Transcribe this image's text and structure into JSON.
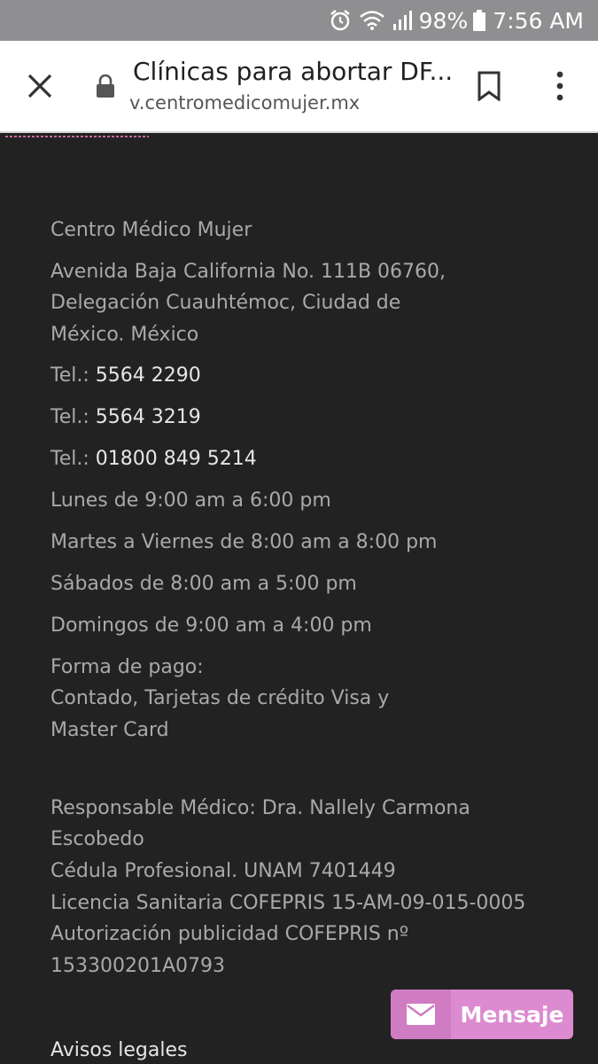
{
  "status_bar": {
    "battery": "98%",
    "time": "7:56 AM"
  },
  "browser": {
    "title": "Clínicas para abortar DF...",
    "url": "v.centromedicomujer.mx"
  },
  "clinic": {
    "name": "Centro Médico Mujer",
    "address": [
      "Avenida Baja California No. 111B 06760,",
      "Delegación Cuauhtémoc, Ciudad de",
      "México. México"
    ],
    "phones": [
      {
        "label": "Tel.:",
        "number": "5564 2290"
      },
      {
        "label": "Tel.:",
        "number": "5564 3219"
      },
      {
        "label": "Tel.:",
        "number": "01800 849 5214"
      }
    ],
    "hours": [
      "Lunes de 9:00 am a 6:00 pm",
      "Martes a Viernes de 8:00 am a 8:00 pm",
      "Sábados de 8:00 am a 5:00 pm",
      "Domingos de 9:00 am a 4:00 pm"
    ],
    "payment": [
      "Forma de pago:",
      "Contado, Tarjetas de crédito Visa y",
      "Master Card"
    ],
    "responsible": [
      "Responsable Médico: Dra. Nallely Carmona",
      "Escobedo",
      "Cédula Profesional. UNAM 7401449",
      "Licencia Sanitaria COFEPRIS 15-AM-09-015-0005",
      "Autorización publicidad COFEPRIS nº",
      "153300201A0793"
    ]
  },
  "chat_button": {
    "label": "Mensaje"
  },
  "footer": {
    "legal_link": "Avisos legales"
  },
  "colors": {
    "page_bg": "#222223",
    "status_bg": "#8f8f91",
    "chat_button": "#dc8bd0",
    "text_muted": "#a9a9a9"
  }
}
